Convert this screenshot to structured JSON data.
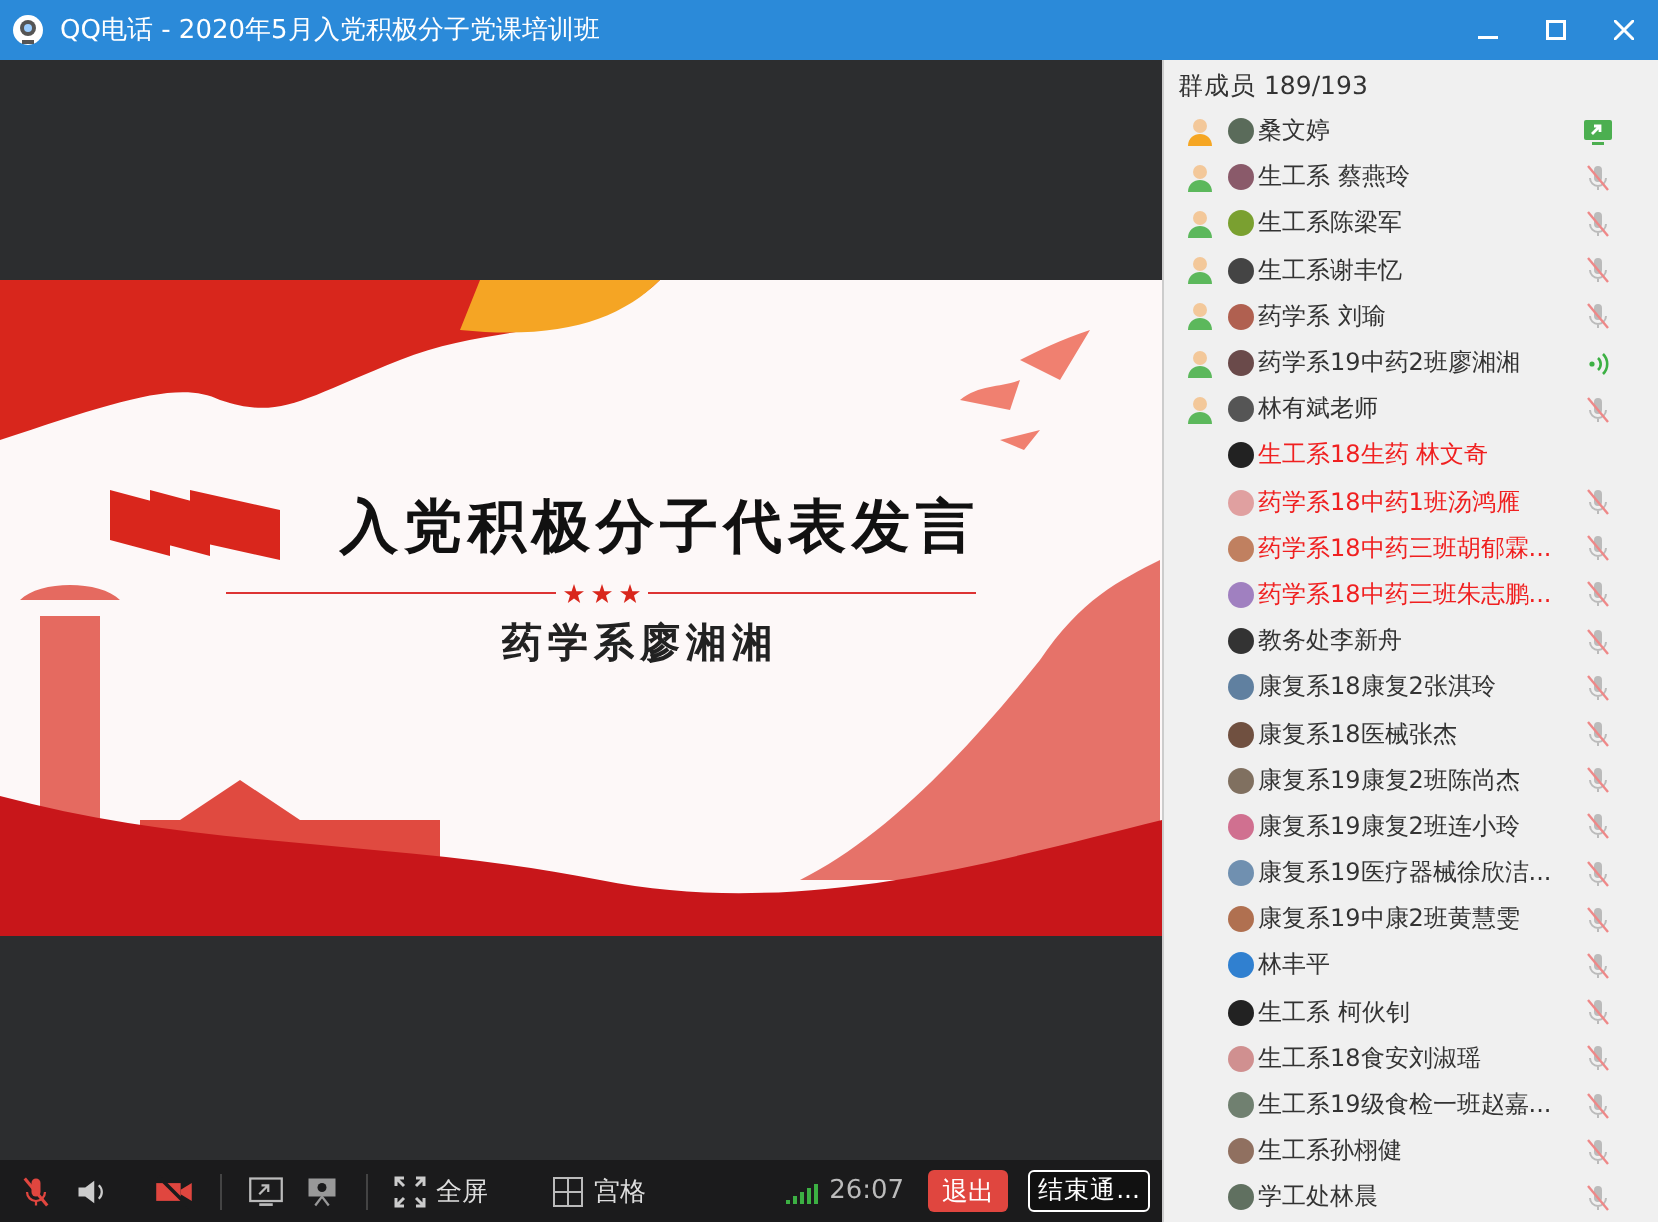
{
  "window": {
    "title": "QQ电话 - 2020年5月入党积极分子党课培训班"
  },
  "slide": {
    "title": "入党积极分子代表发言",
    "subtitle": "药学系廖湘湘"
  },
  "members_panel": {
    "header": "群成员 189/193",
    "members": [
      {
        "name": "桑文婷",
        "color": "#f5a623",
        "highlighted": false,
        "kind": "sharing"
      },
      {
        "name": "生工系 蔡燕玲",
        "color": "#5cb85c",
        "highlighted": false,
        "kind": "muted"
      },
      {
        "name": "生工系陈梁军",
        "color": "#5cb85c",
        "highlighted": false,
        "kind": "muted"
      },
      {
        "name": "生工系谢丰忆",
        "color": "#5cb85c",
        "highlighted": false,
        "kind": "muted"
      },
      {
        "name": "药学系 刘瑜",
        "color": "#5cb85c",
        "highlighted": false,
        "kind": "muted"
      },
      {
        "name": "药学系19中药2班廖湘湘",
        "color": "#5cb85c",
        "highlighted": false,
        "kind": "speaking"
      },
      {
        "name": "林有斌老师",
        "color": "#5cb85c",
        "highlighted": false,
        "kind": "muted"
      },
      {
        "name": "生工系18生药 林文奇",
        "highlighted": true,
        "kind": "silent"
      },
      {
        "name": "药学系18中药1班汤鸿雁",
        "highlighted": true,
        "kind": "muted"
      },
      {
        "name": "药学系18中药三班胡郁霖...",
        "highlighted": true,
        "kind": "muted"
      },
      {
        "name": "药学系18中药三班朱志鹏...",
        "highlighted": true,
        "kind": "muted"
      },
      {
        "name": "教务处李新舟",
        "highlighted": false,
        "kind": "muted"
      },
      {
        "name": "康复系18康复2张淇玲",
        "highlighted": false,
        "kind": "muted"
      },
      {
        "name": "康复系18医械张杰",
        "highlighted": false,
        "kind": "muted"
      },
      {
        "name": "康复系19康复2班陈尚杰",
        "highlighted": false,
        "kind": "muted"
      },
      {
        "name": "康复系19康复2班连小玲",
        "highlighted": false,
        "kind": "muted"
      },
      {
        "name": "康复系19医疗器械徐欣洁...",
        "highlighted": false,
        "kind": "muted"
      },
      {
        "name": "康复系19中康2班黄慧雯",
        "highlighted": false,
        "kind": "muted"
      },
      {
        "name": "林丰平",
        "highlighted": false,
        "kind": "muted"
      },
      {
        "name": "生工系 柯伙钊",
        "highlighted": false,
        "kind": "muted"
      },
      {
        "name": "生工系18食安刘淑瑶",
        "highlighted": false,
        "kind": "muted"
      },
      {
        "name": "生工系19级食检一班赵嘉...",
        "highlighted": false,
        "kind": "muted"
      },
      {
        "name": "生工系孙栩健",
        "highlighted": false,
        "kind": "muted"
      },
      {
        "name": "学工处林晨",
        "highlighted": false,
        "kind": "muted"
      }
    ]
  },
  "toolbar": {
    "mic_muted": true,
    "camera_off": true,
    "fullscreen_label": "全屏",
    "grid_label": "宫格",
    "duration": "26:07",
    "exit_button": "退出",
    "end_button": "结束通..."
  }
}
